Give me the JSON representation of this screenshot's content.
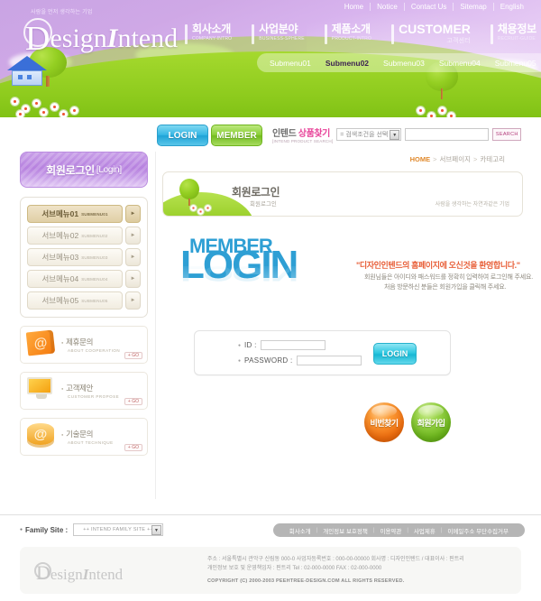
{
  "header": {
    "tagline": "사람을 먼저 생각하는 기업",
    "logo": {
      "d": "D",
      "rest": "esign",
      "i": "I",
      "tail": "ntend"
    },
    "util_nav": [
      "Home",
      "Notice",
      "Contact Us",
      "Sitemap",
      "English"
    ],
    "gnb": [
      {
        "ko": "회사소개",
        "en": "COMPANY-INTRO"
      },
      {
        "ko": "사업분야",
        "en": "BUSINESS-SPHERE"
      },
      {
        "ko": "제품소개",
        "en": "PRODUCT-INTRO"
      },
      {
        "ko": "CUSTOMER",
        "en": "고객센터"
      },
      {
        "ko": "채용정보",
        "en": "RECRUIT-GUIDE"
      }
    ],
    "submenu": [
      {
        "label": "Submenu01",
        "active": false
      },
      {
        "label": "Submenu02",
        "active": true
      },
      {
        "label": "Submenu03",
        "active": false
      },
      {
        "label": "Submenu04",
        "active": false
      },
      {
        "label": "Submenu05",
        "active": false
      }
    ]
  },
  "tabs": {
    "login": "LOGIN",
    "member": "MEMBER"
  },
  "product_search": {
    "title_ko_1": "인텐드 ",
    "title_ko_2": "상품찾기",
    "title_en": "[INTEND PRODUCT SEARCH]",
    "select_value": "= 검색조건을 선택 =",
    "input_value": "",
    "button": "SEARCH"
  },
  "sidebar": {
    "title_ko": "회원로그인",
    "title_en": "[Login]",
    "menu": [
      {
        "ko": "서브메뉴01",
        "en": "SUBMENU01",
        "active": true
      },
      {
        "ko": "서브메뉴02",
        "en": "SUBMENU02",
        "active": false
      },
      {
        "ko": "서브메뉴03",
        "en": "SUBMENU03",
        "active": false
      },
      {
        "ko": "서브메뉴04",
        "en": "SUBMENU04",
        "active": false
      },
      {
        "ko": "서브메뉴05",
        "en": "SUBMENU05",
        "active": false
      }
    ],
    "banners": [
      {
        "ko": "제휴문의",
        "en": "ABOUT COOPERATION",
        "go": "+ GO",
        "icon": "book-at-icon"
      },
      {
        "ko": "고객제안",
        "en": "CUSTOMER PROPOSE",
        "go": "+ GO",
        "icon": "monitor-icon"
      },
      {
        "ko": "기술문의",
        "en": "ABOUT TECHNIQUE",
        "go": "+ GO",
        "icon": "at-cylinder-icon"
      }
    ]
  },
  "content": {
    "breadcrumb": {
      "home": "HOME",
      "level1": "서브페이지",
      "level2": "카테고리"
    },
    "title_box": {
      "title_ko": "회원로그인",
      "subtitle": "회원로그인",
      "right_text": "사람을 생각하는 자연과같은 기업"
    },
    "member_login": {
      "word_member": "MEMBER",
      "word_login": "LOGIN",
      "quote": "\"디자인인텐드의 홈페이지에 오신것을 환영합니다.\"",
      "desc1": "회원님들은 아이디와 패스워드를 정확히 입력하여 로그인해 주세요.",
      "desc2": "처음 방문하신 분들은 회원가입을 클릭해 주세요."
    },
    "form": {
      "id_label": "ID :",
      "password_label": "PASSWORD :",
      "id_value": "",
      "password_value": "",
      "login_button": "LOGIN"
    },
    "round_buttons": [
      {
        "label": "비번찾기",
        "color": "#ef6f10"
      },
      {
        "label": "회원가입",
        "color": "#6fb81f"
      }
    ]
  },
  "footer": {
    "family_site_label": "Family Site :",
    "family_site_value": "++ INTEND FAMILY SITE ++",
    "links": [
      "회사소개",
      "개인정보 보호정책",
      "이용약관",
      "사업제휴",
      "이메일주소 무단수집거부"
    ],
    "logo": {
      "d": "D",
      "rest": "esign",
      "i": "I",
      "tail": "ntend"
    },
    "address_line1": "주소 : 서울특별시 관악구 신림동 000-0  사업자등록번호 : 000-00-00000 회사명 : 디자인인텐드  / 대표이사 : 핀트리",
    "address_line2": "개인정보 보호 및 운영책임자 :  핀트리   Tel : 02-000-0000  FAX : 02-000-0000",
    "copyright": "COPYRIGHT (C) 2000-2003 PEEHTREE-DESIGN.COM  ALL RIGHTS RESERVED."
  }
}
